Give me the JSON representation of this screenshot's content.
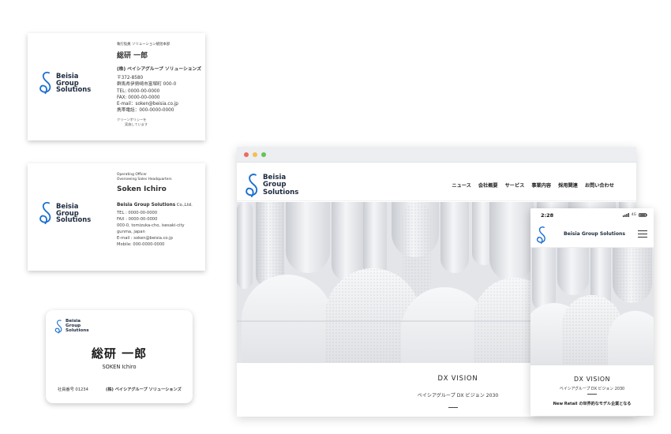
{
  "colors": {
    "brand_blue": "#1b6fd0",
    "logo_text": "#1c2a3d",
    "dot_red": "#ee6a5e",
    "dot_yellow": "#f5bf4f",
    "dot_green": "#61c454"
  },
  "logo": {
    "line1": "Beisia",
    "line2": "Group",
    "line3": "Solutions",
    "icon": "script-s-logo-icon"
  },
  "card_jp": {
    "title": "執行役員 ソリューション統括本部",
    "name": "総研 一郎",
    "company": "(株) ベイシアグループ ソリューションズ",
    "lines": [
      "〒372-8580",
      "群馬県伊勢崎市富塚町 000-0",
      "TEL: 0000-00-0000",
      "FAX: 0000-00-0000",
      "E-mail：soken@beisia.co.jp",
      "携帯電話：000-0000-0000"
    ],
    "clean_1": "クリーンポリシーを",
    "clean_2": "実施しています"
  },
  "card_en": {
    "title_1": "Operating Officer",
    "title_2": "Overseeing Sales Headquarters",
    "name": "Soken Ichiro",
    "company": "Beisia Group Solutions",
    "company_suffix": " Co.,Ltd.",
    "lines": [
      "TEL : 0000-00-0000",
      "FAX : 0000-00-0000",
      "000-0, tomizuka-cho, isesaki-city",
      "gunma, japan",
      "E-mail : soken@beisia.co.jp",
      "Mobile: 000-0000-0000"
    ]
  },
  "id_card": {
    "name_jp": "総研 一郎",
    "name_en": "SOKEN Ichiro",
    "employee_no": "社員番号 01234",
    "company": "(株) ベイシアグループ ソリューションズ"
  },
  "browser": {
    "nav": [
      "ニュース",
      "会社概要",
      "サービス",
      "事業内容",
      "採用関連",
      "お問い合わせ"
    ],
    "dx_title": "DX VISION",
    "dx_subtitle": "ベイシアグループ DX ビジョン 2030"
  },
  "phone": {
    "time": "2:28",
    "network": "4G",
    "brand": "Beisia Group Solutions",
    "dx_title": "DX VISION",
    "dx_subtitle": "ベイシアグループ DX ビジョン 2030",
    "lead": "New Retail の世界的なモデル企業となる"
  }
}
